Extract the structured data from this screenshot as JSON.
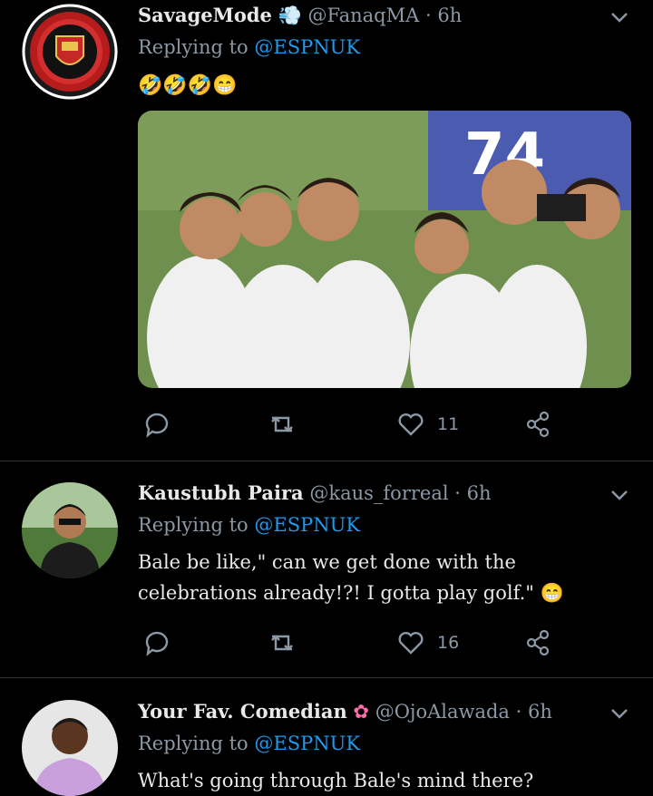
{
  "tweets": [
    {
      "name": "SavageMode",
      "handle": "@FanaqMA",
      "time": "· 6h",
      "replying_prefix": "Replying to",
      "replying_to": "@ESPNUK",
      "emoji_text": "🤣🤣🤣😁",
      "has_media": true,
      "like_count": "11",
      "avatar_icon": "manchester-united-crest"
    },
    {
      "name": "Kaustubh Paira",
      "handle": "@kaus_forreal",
      "time": "· 6h",
      "replying_prefix": "Replying to",
      "replying_to": "@ESPNUK",
      "text": "Bale be like,\" can we get done with the celebrations already!?! I gotta play golf.\" 😁",
      "like_count": "16"
    },
    {
      "name": "Your Fav. Comedian",
      "handle": "@OjoAlawada",
      "time": "· 6h",
      "replying_prefix": "Replying to",
      "replying_to": "@ESPNUK",
      "text": "What's going through Bale's mind there?"
    }
  ],
  "colors": {
    "background": "#000000",
    "mention": "#1d9bf0",
    "muted": "#8b98a5",
    "divider": "#2f3336"
  }
}
